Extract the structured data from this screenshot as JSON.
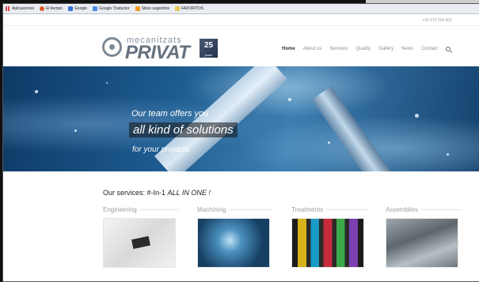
{
  "bookmarks": [
    {
      "label": "Aplicaciones",
      "icon": "apps-icon"
    },
    {
      "label": "El tiempo",
      "icon": "weather-icon"
    },
    {
      "label": "Google",
      "icon": "google-icon"
    },
    {
      "label": "Google Traductor",
      "icon": "translate-icon"
    },
    {
      "label": "Sitios sugeridos",
      "icon": "suggested-sites-icon"
    },
    {
      "label": "FAVORITOS",
      "icon": "folder-icon"
    }
  ],
  "topbar": {
    "phone": "+34 972 594 602"
  },
  "logo": {
    "small_text": "mecanitzats",
    "big_text": "PRIVAT",
    "badge_number": "25",
    "badge_sub": "years"
  },
  "nav": {
    "items": [
      "Home",
      "About us",
      "Services",
      "Quality",
      "Gallery",
      "News",
      "Contact"
    ],
    "active": "Home"
  },
  "hero": {
    "line1": "Our team offers you",
    "line2": "all kind of solutions",
    "line3": "for your projects"
  },
  "services": {
    "title_prefix": "Our services: #-In-1 ",
    "title_emphasis": "ALL IN ONE !",
    "items": [
      "Engineering",
      "Machining",
      "Treatments",
      "Assemblies"
    ]
  },
  "colors": {
    "accent": "#66727e",
    "hero_blue": "#1d5b8f"
  }
}
